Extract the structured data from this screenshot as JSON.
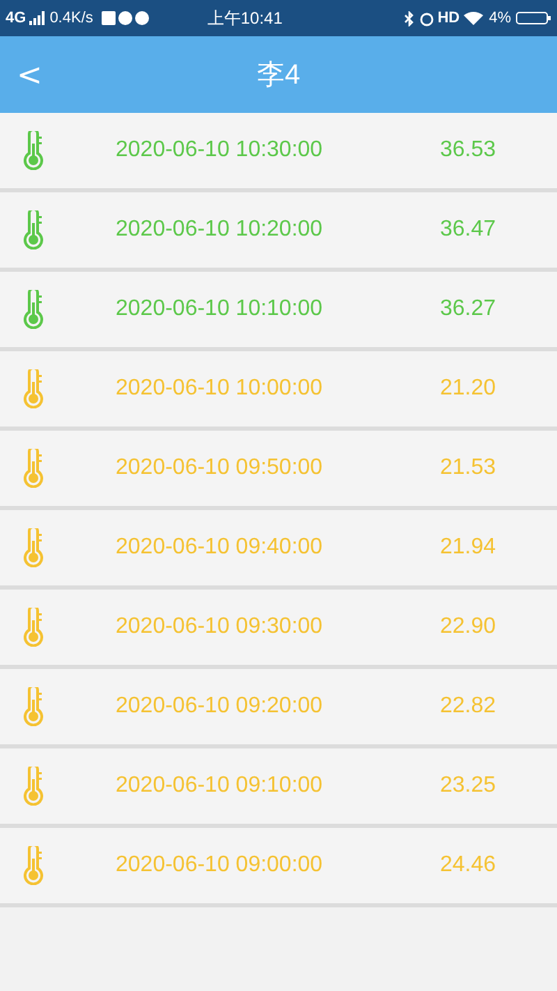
{
  "status_bar": {
    "network": "4G",
    "speed": "0.4K/s",
    "time": "上午10:41",
    "hd": "HD",
    "battery": "4%"
  },
  "header": {
    "back": "<",
    "title": "李4"
  },
  "rows": [
    {
      "time": "2020-06-10 10:30:00",
      "value": "36.53",
      "color": "#5cc84a"
    },
    {
      "time": "2020-06-10 10:20:00",
      "value": "36.47",
      "color": "#5cc84a"
    },
    {
      "time": "2020-06-10 10:10:00",
      "value": "36.27",
      "color": "#5cc84a"
    },
    {
      "time": "2020-06-10 10:00:00",
      "value": "21.20",
      "color": "#f5c232"
    },
    {
      "time": "2020-06-10 09:50:00",
      "value": "21.53",
      "color": "#f5c232"
    },
    {
      "time": "2020-06-10 09:40:00",
      "value": "21.94",
      "color": "#f5c232"
    },
    {
      "time": "2020-06-10 09:30:00",
      "value": "22.90",
      "color": "#f5c232"
    },
    {
      "time": "2020-06-10 09:20:00",
      "value": "22.82",
      "color": "#f5c232"
    },
    {
      "time": "2020-06-10 09:10:00",
      "value": "23.25",
      "color": "#f5c232"
    },
    {
      "time": "2020-06-10 09:00:00",
      "value": "24.46",
      "color": "#f5c232"
    }
  ]
}
